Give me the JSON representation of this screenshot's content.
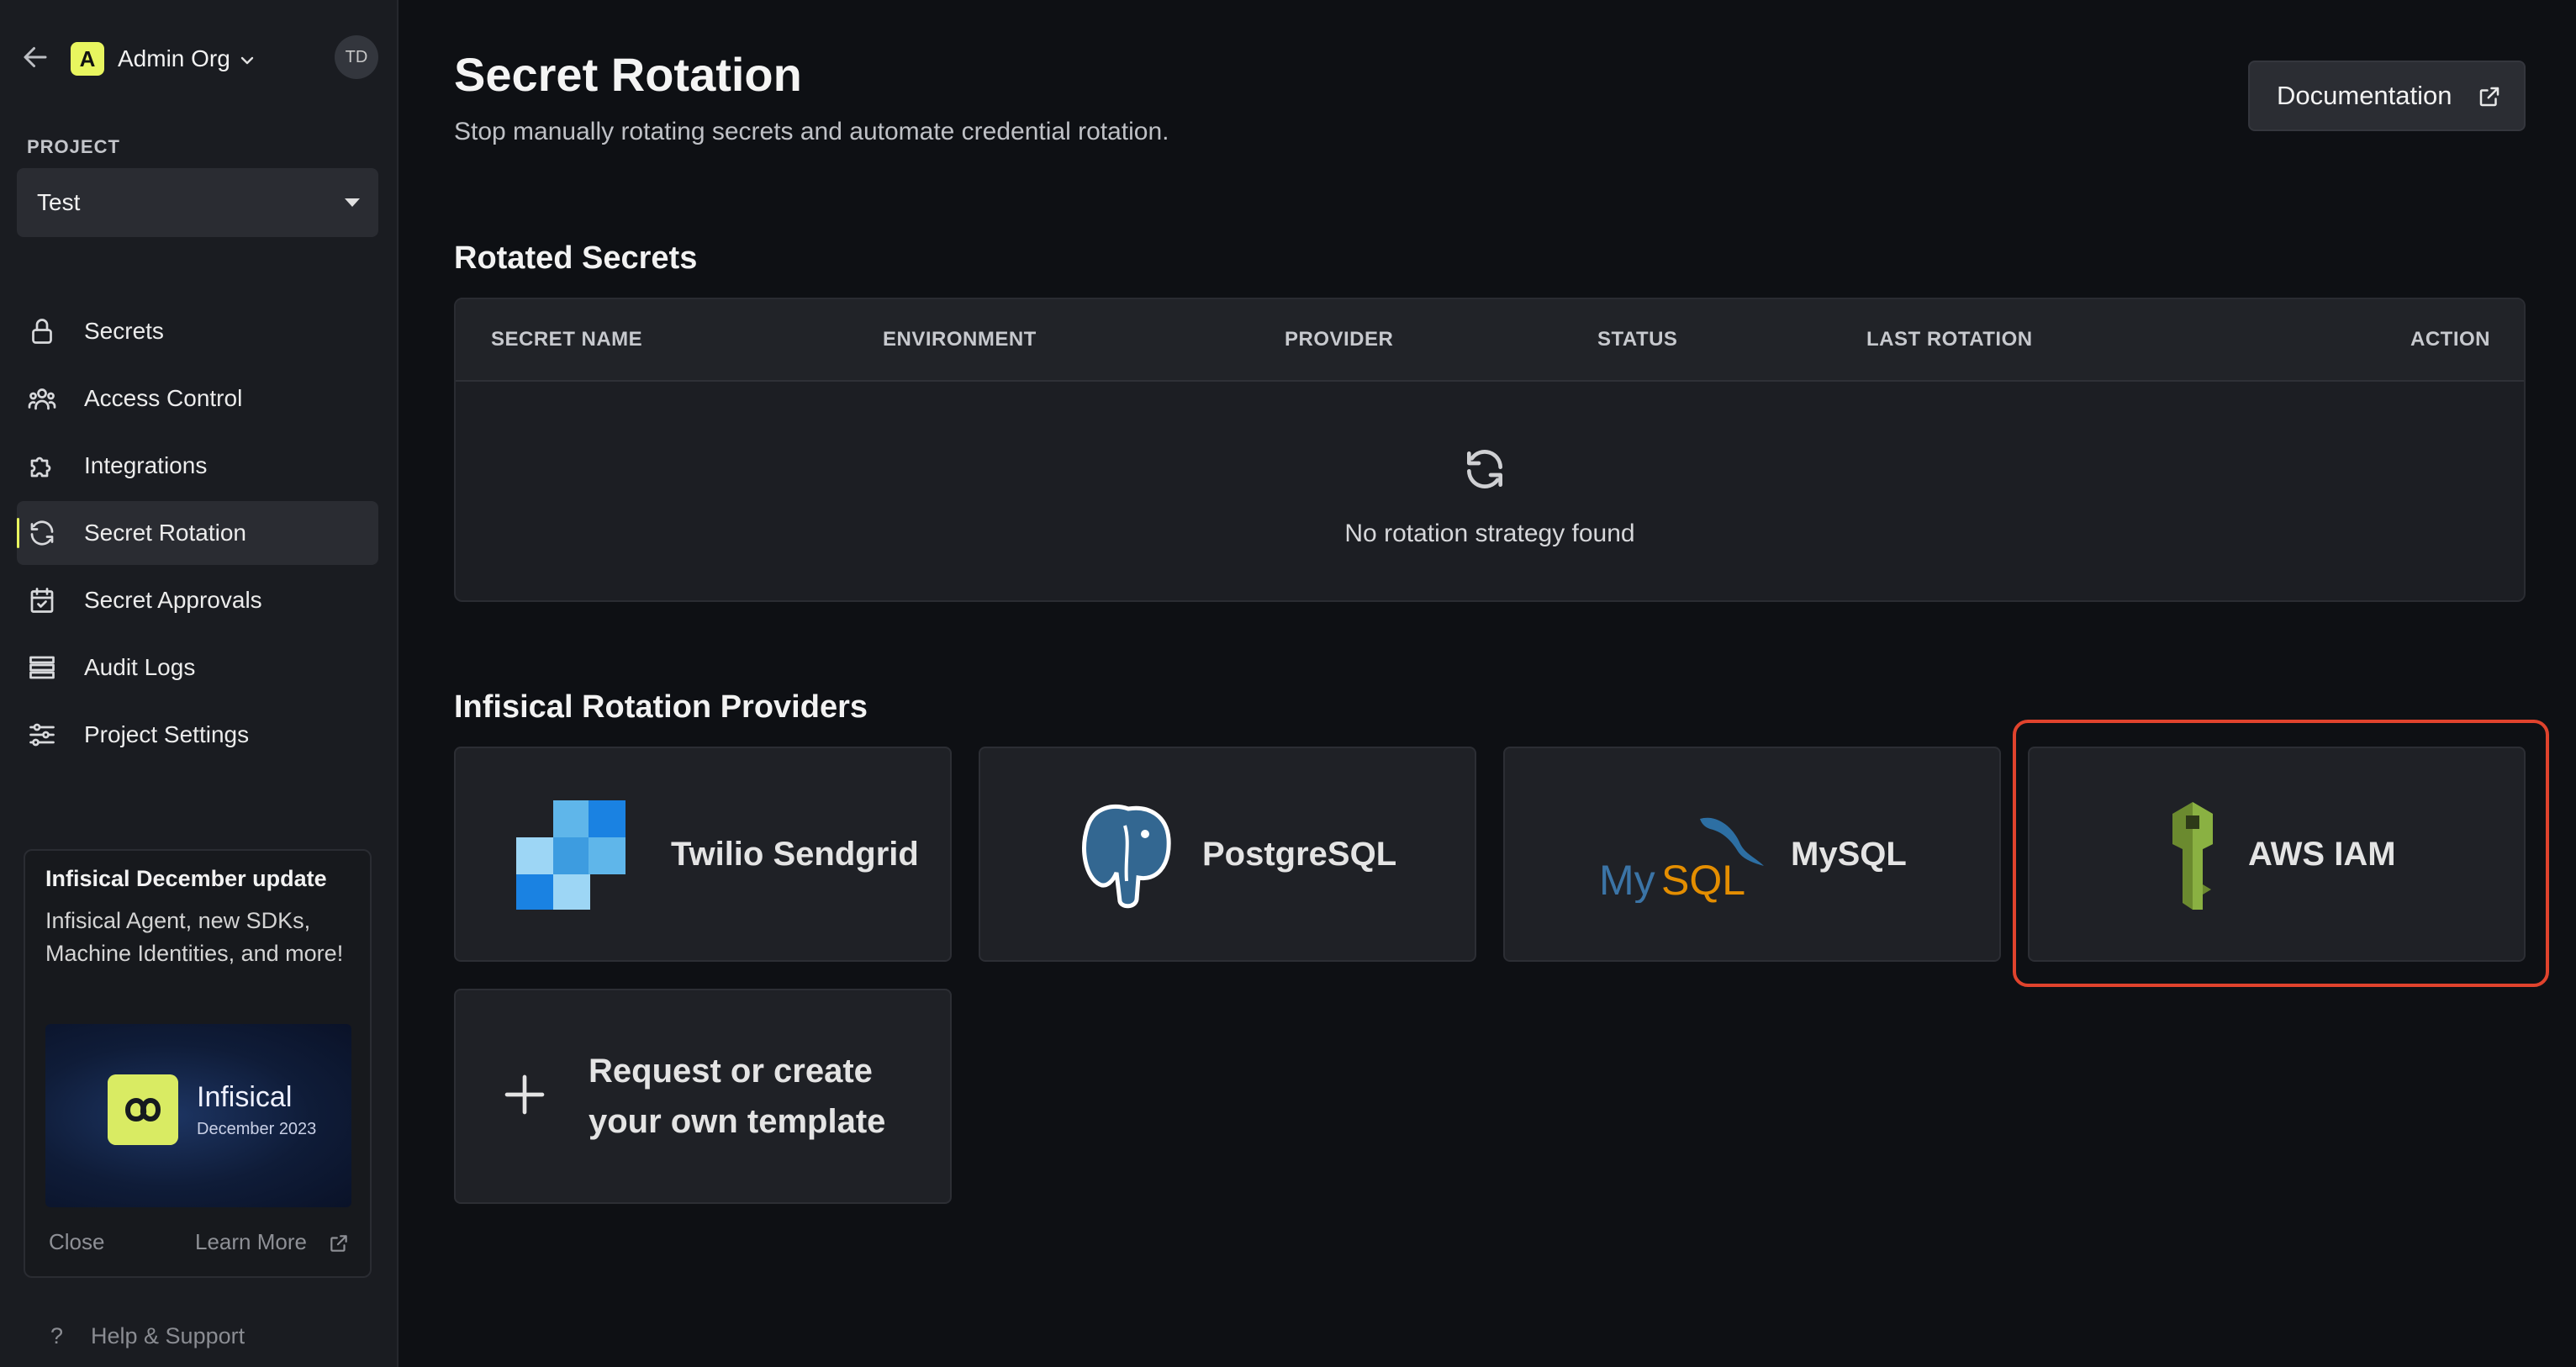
{
  "sidebar": {
    "org_initial": "A",
    "org_name": "Admin Org",
    "user_initials": "TD",
    "project_label": "PROJECT",
    "project_value": "Test",
    "nav": [
      {
        "label": "Secrets",
        "icon": "lock-icon"
      },
      {
        "label": "Access Control",
        "icon": "users-icon"
      },
      {
        "label": "Integrations",
        "icon": "puzzle-icon"
      },
      {
        "label": "Secret Rotation",
        "icon": "rotate-icon",
        "active": true
      },
      {
        "label": "Secret Approvals",
        "icon": "calendar-check-icon"
      },
      {
        "label": "Audit Logs",
        "icon": "logs-icon"
      },
      {
        "label": "Project Settings",
        "icon": "sliders-icon"
      }
    ],
    "promo": {
      "title": "Infisical December update",
      "description": "Infisical Agent, new SDKs, Machine Identities, and more!",
      "brand": "Infisical",
      "brand_sub": "December 2023",
      "close": "Close",
      "learn_more": "Learn More"
    },
    "help": "Help & Support"
  },
  "main": {
    "title": "Secret Rotation",
    "subtitle": "Stop manually rotating secrets and automate credential rotation.",
    "documentation": "Documentation",
    "rotated_heading": "Rotated Secrets",
    "table": {
      "columns": [
        "SECRET NAME",
        "ENVIRONMENT",
        "PROVIDER",
        "STATUS",
        "LAST ROTATION",
        "ACTION"
      ],
      "empty": "No rotation strategy found"
    },
    "providers_heading": "Infisical Rotation Providers",
    "providers": [
      {
        "name": "Twilio Sendgrid"
      },
      {
        "name": "PostgreSQL"
      },
      {
        "name": "MySQL",
        "logo_text": "MySQL"
      },
      {
        "name": "AWS IAM"
      }
    ],
    "custom_template": "Request or create your own template"
  },
  "colors": {
    "accent": "#e8f55f",
    "highlight": "#e0432d",
    "background": "#0e1014"
  }
}
